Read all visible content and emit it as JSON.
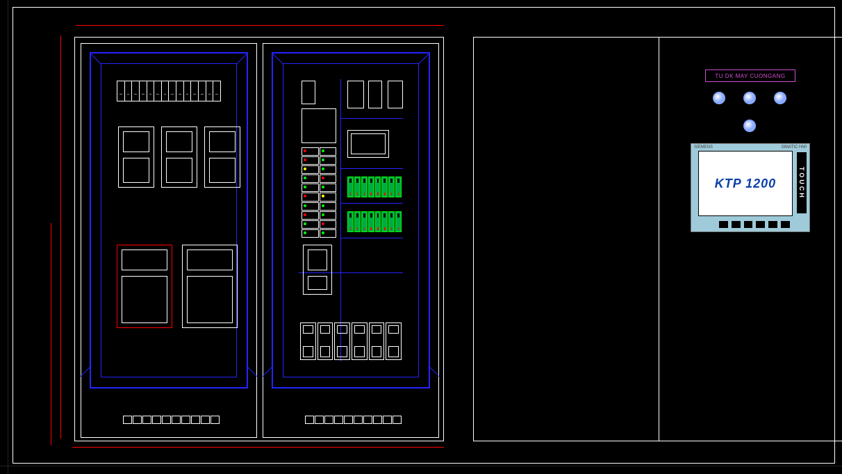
{
  "nameplate": "TU DK MAY CUONGANG",
  "hmi": {
    "model": "KTP 1200",
    "side_label": "TOUCH",
    "brand_left": "SIEMENS",
    "brand_right": "SIMATIC HMI"
  },
  "colors": {
    "outline": "#ffffff",
    "panel_frame": "#2424ff",
    "dimension": "#ff0000",
    "relay": "#00ff00",
    "nameplate": "#d04fd0",
    "hmi_bezel": "#9fcad9",
    "hmi_text": "#0b3fa8"
  },
  "panel1": {
    "breaker_count": 14,
    "vfd_small_count": 3,
    "vfd_large_count": 2,
    "terminal_count": 10
  },
  "panel2": {
    "relay_row_a": 8,
    "relay_row_b": 8,
    "contactor_count": 6,
    "terminal_count": 10,
    "io_rows": 10
  },
  "door": {
    "indicator_count": 4
  }
}
